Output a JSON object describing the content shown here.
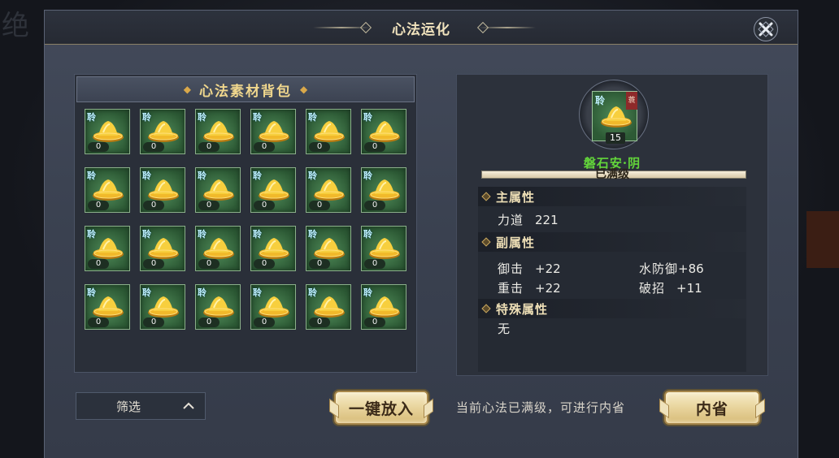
{
  "window": {
    "title": "心法运化"
  },
  "bag": {
    "title": "心法素材背包",
    "items": [
      {
        "glyph": "聆",
        "count": "0"
      },
      {
        "glyph": "聆",
        "count": "0"
      },
      {
        "glyph": "聆",
        "count": "0"
      },
      {
        "glyph": "聆",
        "count": "0"
      },
      {
        "glyph": "聆",
        "count": "0"
      },
      {
        "glyph": "聆",
        "count": "0"
      },
      {
        "glyph": "聆",
        "count": "0"
      },
      {
        "glyph": "聆",
        "count": "0"
      },
      {
        "glyph": "聆",
        "count": "0"
      },
      {
        "glyph": "聆",
        "count": "0"
      },
      {
        "glyph": "聆",
        "count": "0"
      },
      {
        "glyph": "聆",
        "count": "0"
      },
      {
        "glyph": "聆",
        "count": "0"
      },
      {
        "glyph": "聆",
        "count": "0"
      },
      {
        "glyph": "聆",
        "count": "0"
      },
      {
        "glyph": "聆",
        "count": "0"
      },
      {
        "glyph": "聆",
        "count": "0"
      },
      {
        "glyph": "聆",
        "count": "0"
      },
      {
        "glyph": "聆",
        "count": "0"
      },
      {
        "glyph": "聆",
        "count": "0"
      },
      {
        "glyph": "聆",
        "count": "0"
      },
      {
        "glyph": "聆",
        "count": "0"
      },
      {
        "glyph": "聆",
        "count": "0"
      },
      {
        "glyph": "聆",
        "count": "0"
      }
    ],
    "item_icon": "gold-ingot-icon"
  },
  "filter": {
    "label": "筛选"
  },
  "actions": {
    "one_click": "一键放入",
    "hint": "当前心法已满级，可进行内省",
    "neisheng": "内省"
  },
  "detail": {
    "item": {
      "glyph": "聆",
      "tag": "蓑",
      "level": "15",
      "name": "磐石安·阴"
    },
    "progress": {
      "text": "已满级",
      "fraction": 1.0
    },
    "main_attr": {
      "title": "主属性",
      "rows": [
        {
          "label": "力道",
          "value": "221"
        }
      ]
    },
    "sub_attr": {
      "title": "副属性",
      "rows": [
        {
          "label": "御击",
          "value": "+22"
        },
        {
          "label": "水防御",
          "value": "+86"
        },
        {
          "label": "重击",
          "value": "+22"
        },
        {
          "label": "破招",
          "value": "+11"
        }
      ]
    },
    "special_attr": {
      "title": "特殊属性",
      "value": "无"
    }
  },
  "colors": {
    "accent_gold": "#f0d78d",
    "item_name_green": "#63d63a",
    "slot_green": "#2d5a35"
  }
}
